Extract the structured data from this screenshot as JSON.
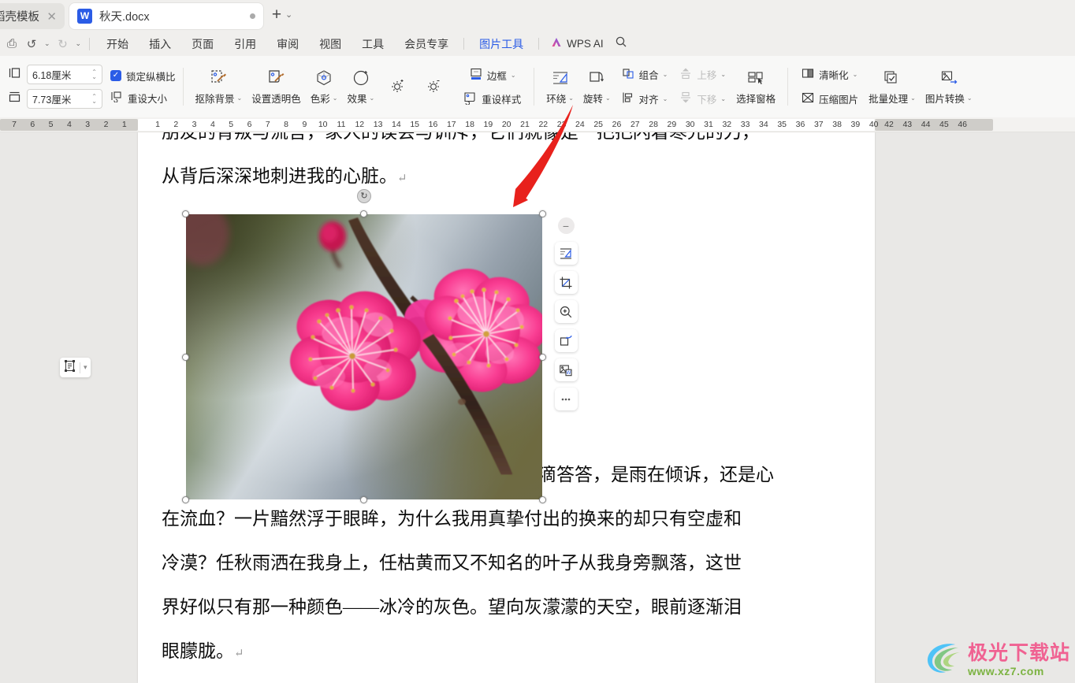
{
  "window": {
    "tabs": [
      {
        "label": "稻壳模板",
        "active": false,
        "icon": "none",
        "close_icon": "close-icon"
      },
      {
        "label": "秋天.docx",
        "active": true,
        "icon": "wps-writer-icon",
        "badge": "W",
        "modified_dot": true
      }
    ],
    "new_tab_label": "+",
    "tab_menu_caret": "chevron-down-icon"
  },
  "quick_access": {
    "buttons": [
      {
        "name": "save-icon",
        "glyph": "⎙"
      },
      {
        "name": "undo-icon",
        "glyph": "↺"
      },
      {
        "name": "undo-caret-icon",
        "glyph": "⌄"
      },
      {
        "name": "redo-icon",
        "glyph": "↻"
      },
      {
        "name": "customize-caret-icon",
        "glyph": "⌄"
      }
    ]
  },
  "menu": {
    "items": [
      {
        "label": "开始",
        "active": false
      },
      {
        "label": "插入",
        "active": false
      },
      {
        "label": "页面",
        "active": false
      },
      {
        "label": "引用",
        "active": false
      },
      {
        "label": "审阅",
        "active": false
      },
      {
        "label": "视图",
        "active": false
      },
      {
        "label": "工具",
        "active": false
      },
      {
        "label": "会员专享",
        "active": false
      },
      {
        "label": "图片工具",
        "active": true
      }
    ],
    "ai_label": "WPS AI",
    "ai_icon": "wps-ai-icon",
    "search_icon": "search-icon"
  },
  "ribbon": {
    "size": {
      "height_icon": "picture-height-icon",
      "width_icon": "picture-width-icon",
      "height_value": "6.18厘米",
      "width_value": "7.73厘米",
      "lock_ratio_label": "锁定纵横比",
      "lock_ratio_checked": true,
      "reset_size_label": "重设大小",
      "reset_size_icon": "reset-size-icon"
    },
    "adjust": [
      {
        "label": "抠除背景",
        "icon": "remove-background-icon",
        "dropdown": true,
        "disabled": false
      },
      {
        "label": "设置透明色",
        "icon": "set-transparent-color-icon",
        "dropdown": false,
        "disabled": false
      },
      {
        "label": "色彩",
        "icon": "color-icon",
        "dropdown": true,
        "disabled": false
      },
      {
        "label": "效果",
        "icon": "effects-icon",
        "dropdown": true,
        "disabled": false
      }
    ],
    "small_adjust": [
      {
        "label": "",
        "icon": "brightness-up-icon"
      },
      {
        "label": "",
        "icon": "brightness-down-icon"
      }
    ],
    "style": [
      {
        "label": "边框",
        "icon": "picture-border-icon",
        "dropdown": true
      },
      {
        "label": "重设样式",
        "icon": "reset-style-icon",
        "dropdown": false
      }
    ],
    "arrange": [
      {
        "label": "环绕",
        "icon": "text-wrap-icon",
        "dropdown": true,
        "disabled": false
      },
      {
        "label": "旋转",
        "icon": "rotate-icon",
        "dropdown": true,
        "disabled": false
      }
    ],
    "arrange_small": [
      {
        "label": "组合",
        "icon": "group-icon",
        "dropdown": true,
        "disabled": false
      },
      {
        "label": "对齐",
        "icon": "align-icon",
        "dropdown": true,
        "disabled": false
      },
      {
        "label": "上移",
        "icon": "bring-forward-icon",
        "dropdown": true,
        "disabled": true
      },
      {
        "label": "下移",
        "icon": "send-backward-icon",
        "dropdown": true,
        "disabled": true
      }
    ],
    "select_pane": {
      "label": "选择窗格",
      "icon": "selection-pane-icon"
    },
    "tools_small": [
      {
        "label": "清晰化",
        "icon": "sharpen-icon",
        "dropdown": true
      },
      {
        "label": "压缩图片",
        "icon": "compress-picture-icon",
        "dropdown": false
      }
    ],
    "batch": {
      "label": "批量处理",
      "icon": "batch-process-icon",
      "dropdown": true
    },
    "convert": {
      "label": "图片转换",
      "icon": "picture-convert-icon",
      "dropdown": true
    }
  },
  "ruler": {
    "left_ticks": [
      "7",
      "6",
      "5",
      "4",
      "3",
      "2",
      "1"
    ],
    "page_ticks": [
      "1",
      "2",
      "3",
      "4",
      "5",
      "6",
      "7",
      "8",
      "9",
      "10",
      "11",
      "12",
      "13",
      "14",
      "15",
      "16",
      "17",
      "18",
      "19",
      "20",
      "21",
      "22",
      "23",
      "24",
      "25",
      "26",
      "27",
      "28",
      "29",
      "30",
      "31",
      "32",
      "33",
      "34",
      "35",
      "36",
      "37",
      "38",
      "39",
      "40"
    ],
    "right_ticks": [
      "42",
      "43",
      "44",
      "45",
      "46"
    ]
  },
  "document": {
    "paragraphs": [
      {
        "text": "朋友的背叛与流言，家人的误会与训斥，它们就像是一把把闪着寒光的刀，",
        "clipped_top": true
      },
      {
        "text": "从背后深深地刺进我的心脏。",
        "mark": "↵"
      }
    ],
    "after_image_text": "滴滴答答，是雨在倾诉，还是心",
    "body_paragraphs": [
      "在流血？一片黯然浮于眼眸，为什么我用真挚付出的换来的却只有空虚和",
      "冷漠？任秋雨洒在我身上，任枯黄而又不知名的叶子从我身旁飘落，这世",
      "界好似只有那一种颜色——冰冷的灰色。望向灰濛濛的天空，眼前逐渐泪",
      "眼朦胧。"
    ],
    "end_mark": "↵"
  },
  "image_selection": {
    "alt": "两朵粉红色梅花特写照片",
    "rotate_handle_icon": "rotate-handle-icon",
    "layout_options_icon": "layout-options-icon",
    "layout_options_caret": "chevron-down-icon"
  },
  "floating_toolbar": {
    "collapse_icon": "collapse-icon",
    "buttons": [
      {
        "name": "text-wrap-icon",
        "label": "环绕"
      },
      {
        "name": "crop-icon",
        "label": "裁剪"
      },
      {
        "name": "zoom-in-icon",
        "label": "放大"
      },
      {
        "name": "rotate-icon",
        "label": "旋转"
      },
      {
        "name": "save-as-picture-icon",
        "label": "另存为图片"
      },
      {
        "name": "more-icon",
        "label": "更多"
      }
    ]
  },
  "watermark": {
    "title": "极光下载站",
    "url": "www.xz7.com",
    "logo_icon": "aurora-logo-icon"
  },
  "colors": {
    "accent": "#2b5ce6",
    "ribbon_bg": "#f8f8f7",
    "menu_bg": "#f0efed",
    "canvas_bg": "#e9e8e6",
    "arrow": "#e8211c",
    "watermark_pink": "#f06292",
    "watermark_green": "#7cb342"
  }
}
